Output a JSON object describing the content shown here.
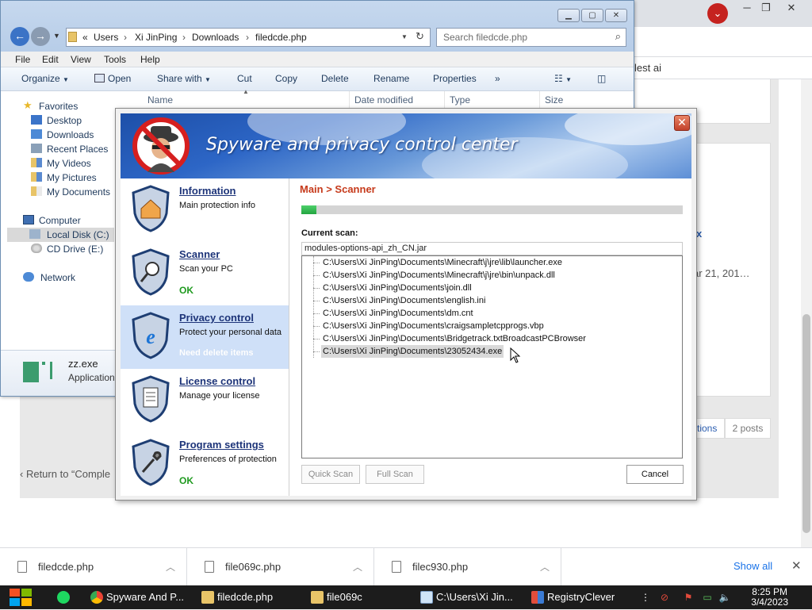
{
  "chrome": {
    "bookmark_fragment": "lest ai",
    "forum_fragments": {
      "x_fragment": "x",
      "date_fragment": "ar 21, 201…",
      "options_fragment": "tions",
      "posts_count": "2 posts",
      "return_link": "Return to “Comple"
    },
    "downloads": [
      {
        "name": "filedcde.php"
      },
      {
        "name": "file069c.php"
      },
      {
        "name": "filec930.php"
      }
    ],
    "show_all": "Show all"
  },
  "explorer": {
    "breadcrumb_prefix": "«",
    "breadcrumb": [
      "Users",
      "Xi JinPing",
      "Downloads",
      "filedcde.php"
    ],
    "search_placeholder": "Search filedcde.php",
    "menu": [
      "File",
      "Edit",
      "View",
      "Tools",
      "Help"
    ],
    "commands": {
      "organize": "Organize",
      "open": "Open",
      "share_with": "Share with",
      "cut": "Cut",
      "copy": "Copy",
      "delete": "Delete",
      "rename": "Rename",
      "properties": "Properties",
      "more": "»"
    },
    "columns": [
      "Name",
      "Date modified",
      "Type",
      "Size"
    ],
    "favorites_label": "Favorites",
    "favorites": [
      "Desktop",
      "Downloads",
      "Recent Places",
      "My Videos",
      "My Pictures",
      "My Documents"
    ],
    "computer_label": "Computer",
    "drives": [
      "Local Disk (C:)",
      "CD Drive (E:)"
    ],
    "network_label": "Network",
    "details": {
      "filename": "zz.exe",
      "filetype": "Application"
    }
  },
  "dialog": {
    "title": "Spyware and privacy control center",
    "breadcrumb": "Main > Scanner",
    "progress_fraction": 0.04,
    "current_scan_label": "Current scan:",
    "current_scan_value": "modules-options-api_zh_CN.jar",
    "scan_items": [
      "C:\\Users\\Xi JinPing\\Documents\\Minecraft\\j\\jre\\lib\\launcher.exe",
      "C:\\Users\\Xi JinPing\\Documents\\Minecraft\\j\\jre\\bin\\unpack.dll",
      "C:\\Users\\Xi JinPing\\Documents\\join.dll",
      "C:\\Users\\Xi JinPing\\Documents\\english.ini",
      "C:\\Users\\Xi JinPing\\Documents\\dm.cnt",
      "C:\\Users\\Xi JinPing\\Documents\\craigsampletcpprogs.vbp",
      "C:\\Users\\Xi JinPing\\Documents\\Bridgetrack.txtBroadcastPCBrowser",
      "C:\\Users\\Xi JinPing\\Documents\\23052434.exe"
    ],
    "selected_item_index": 7,
    "buttons": {
      "quick_scan": "Quick Scan",
      "full_scan": "Full Scan",
      "cancel": "Cancel"
    },
    "sidebar": [
      {
        "title": "Information",
        "desc": "Main protection info",
        "status": ""
      },
      {
        "title": "Scanner",
        "desc": "Scan your PC",
        "status": "OK"
      },
      {
        "title": "Privacy control",
        "desc": "Protect your personal data",
        "status": "Need delete items"
      },
      {
        "title": "License control",
        "desc": "Manage your license",
        "status": ""
      },
      {
        "title": "Program settings",
        "desc": "Preferences of protection",
        "status": "OK"
      }
    ],
    "active_sidebar_index": 2
  },
  "taskbar": {
    "items": [
      {
        "label": "Spyware And P...",
        "icon": "chrome-icon"
      },
      {
        "label": "filedcde.php",
        "icon": "folder-icon"
      },
      {
        "label": "file069c",
        "icon": "folder-icon"
      },
      {
        "label": "C:\\Users\\Xi Jin...",
        "icon": "notepad-icon"
      },
      {
        "label": "RegistryClever",
        "icon": "registry-icon"
      }
    ],
    "time": "8:25 PM",
    "date": "3/4/2023"
  },
  "colors": {
    "breadcrumb_accent": "#c63a1b",
    "sidebar_title": "#1d3479",
    "status_ok": "#1f9a1f",
    "progress": "#23a541",
    "active_sidebar_bg": "#cfe0f8"
  }
}
